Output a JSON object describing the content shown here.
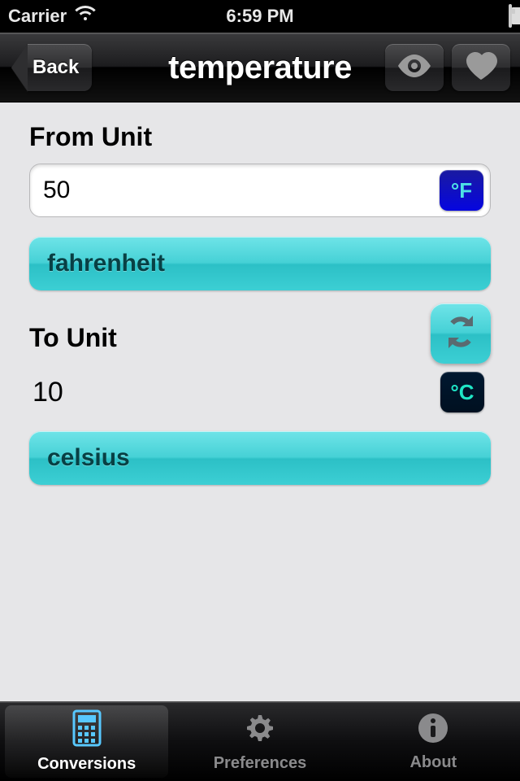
{
  "statusbar": {
    "carrier": "Carrier",
    "time": "6:59 PM"
  },
  "navbar": {
    "back_label": "Back",
    "title": "temperature"
  },
  "from": {
    "section_label": "From Unit",
    "value": "50",
    "unit_symbol": "°F",
    "unit_name": "fahrenheit"
  },
  "to": {
    "section_label": "To Unit",
    "value": "10",
    "unit_symbol": "°C",
    "unit_name": "celsius"
  },
  "tabs": {
    "conversions": "Conversions",
    "preferences": "Preferences",
    "about": "About"
  }
}
